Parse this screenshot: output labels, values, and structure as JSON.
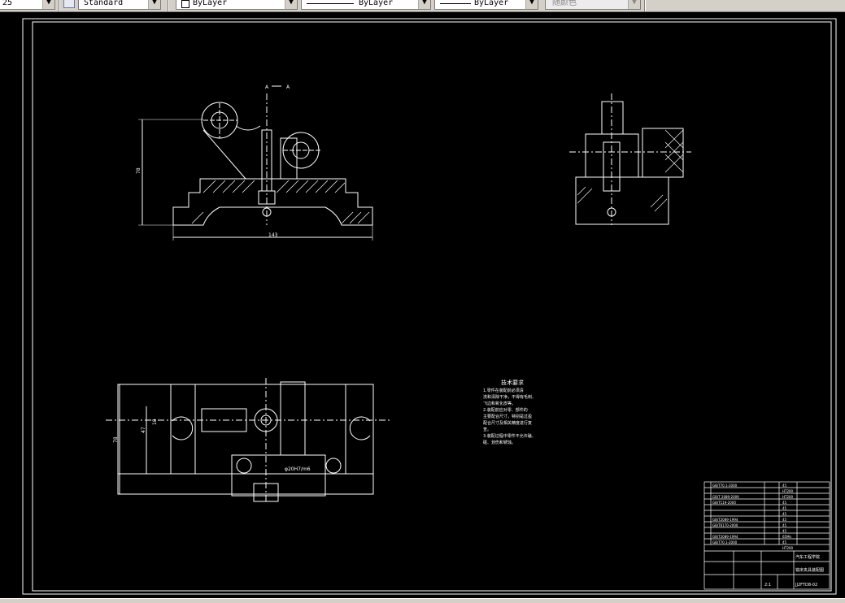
{
  "toolbar": {
    "style_partial": "25",
    "text_style": "Standard",
    "layer": "ByLayer",
    "linetype": "ByLayer",
    "lineweight": "ByLayer",
    "plot_style": "随颜色"
  },
  "drawing": {
    "section_label_left": "A",
    "section_label_right": "A",
    "dim_height_top": "78",
    "dim_width_top": "143",
    "dim_height_bottom": "78",
    "dim_inner_bottom": "47",
    "dim_small_bottom": "18",
    "fit_note": "φ20H7/m6",
    "tech_req_title": "技术要求",
    "tech_req_lines": [
      "1.零件在装配前必须清",
      "洗和清除干净，不得有毛刺、",
      "飞边和氧化皮等。",
      "2.装配前应对零、部件的",
      "主要配合尺寸，特别是过盈",
      "配合尺寸及相关精度进行复",
      "查。",
      "3.装配过程中零件不允许磕、",
      "碰、划伤和锈蚀。"
    ],
    "title_block": {
      "school": "汽车工程学院",
      "drawing_name": "铣床夹具装配图",
      "drawing_number": "JJ2FTD8-02",
      "scale": "2:1"
    },
    "parts": [
      {
        "code": "GB/T70.1-2000",
        "material": "45"
      },
      {
        "code": "",
        "material": "HT200"
      },
      {
        "code": "GB/T 2089-2009",
        "material": "HT200"
      },
      {
        "code": "GB/T119-2000",
        "material": "45"
      },
      {
        "code": "",
        "material": "45"
      },
      {
        "code": "",
        "material": "45"
      },
      {
        "code": "GB/T2089-1994",
        "material": "45"
      },
      {
        "code": "GB/T6170-2000",
        "material": "45"
      },
      {
        "code": "",
        "material": "45"
      },
      {
        "code": "GB/T2089-1994",
        "material": "65Mn"
      },
      {
        "code": "GB/T70.1-2000",
        "material": "45"
      },
      {
        "code": "",
        "material": "HT200"
      }
    ]
  }
}
